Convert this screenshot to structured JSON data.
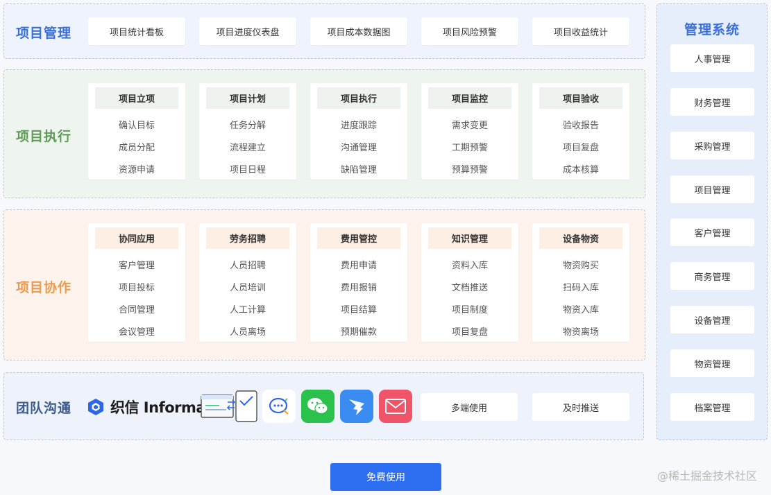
{
  "project_management": {
    "title": "项目管理",
    "buttons": [
      "项目统计看板",
      "项目进度仪表盘",
      "项目成本数据图",
      "项目风险预警",
      "项目收益统计"
    ]
  },
  "project_execution": {
    "title": "项目执行",
    "cards": [
      {
        "title": "项目立项",
        "items": [
          "确认目标",
          "成员分配",
          "资源申请"
        ]
      },
      {
        "title": "项目计划",
        "items": [
          "任务分解",
          "流程建立",
          "项目日程"
        ]
      },
      {
        "title": "项目执行",
        "items": [
          "进度跟踪",
          "沟通管理",
          "缺陷管理"
        ]
      },
      {
        "title": "项目监控",
        "items": [
          "需求变更",
          "工期预警",
          "预算预警"
        ]
      },
      {
        "title": "项目验收",
        "items": [
          "验收报告",
          "项目复盘",
          "成本核算"
        ]
      }
    ]
  },
  "project_collaboration": {
    "title": "项目协作",
    "cards": [
      {
        "title": "协同应用",
        "items": [
          "客户管理",
          "项目投标",
          "合同管理",
          "会议管理"
        ]
      },
      {
        "title": "劳务招聘",
        "items": [
          "人员招聘",
          "人员培训",
          "人工计算",
          "人员离场"
        ]
      },
      {
        "title": "费用管控",
        "items": [
          "费用申请",
          "费用报销",
          "项目结算",
          "预期催款"
        ]
      },
      {
        "title": "知识管理",
        "items": [
          "资料入库",
          "文档推送",
          "项目制度",
          "项目复盘"
        ]
      },
      {
        "title": "设备物资",
        "items": [
          "物资购买",
          "扫码入库",
          "物资入库",
          "物资离场"
        ]
      }
    ]
  },
  "team_communication": {
    "title": "团队沟通",
    "logo_text": "织信 Informat",
    "icons": [
      "doc-sync-icon",
      "chat-bubble-icon",
      "wechat-icon",
      "dingtalk-icon",
      "mail-icon"
    ],
    "buttons": [
      "多端使用",
      "及时推送"
    ]
  },
  "management_system": {
    "title": "管理系统",
    "items": [
      "人事管理",
      "财务管理",
      "采购管理",
      "项目管理",
      "客户管理",
      "商务管理",
      "设备管理",
      "物资管理",
      "档案管理"
    ]
  },
  "cta_label": "免费使用",
  "watermark": "@稀土掘金技术社区",
  "colors": {
    "accent_blue": "#3a6fd8",
    "execution_green": "#5f9a57",
    "collaboration_orange": "#ec9a4e",
    "cta_blue": "#2e6ff2"
  }
}
